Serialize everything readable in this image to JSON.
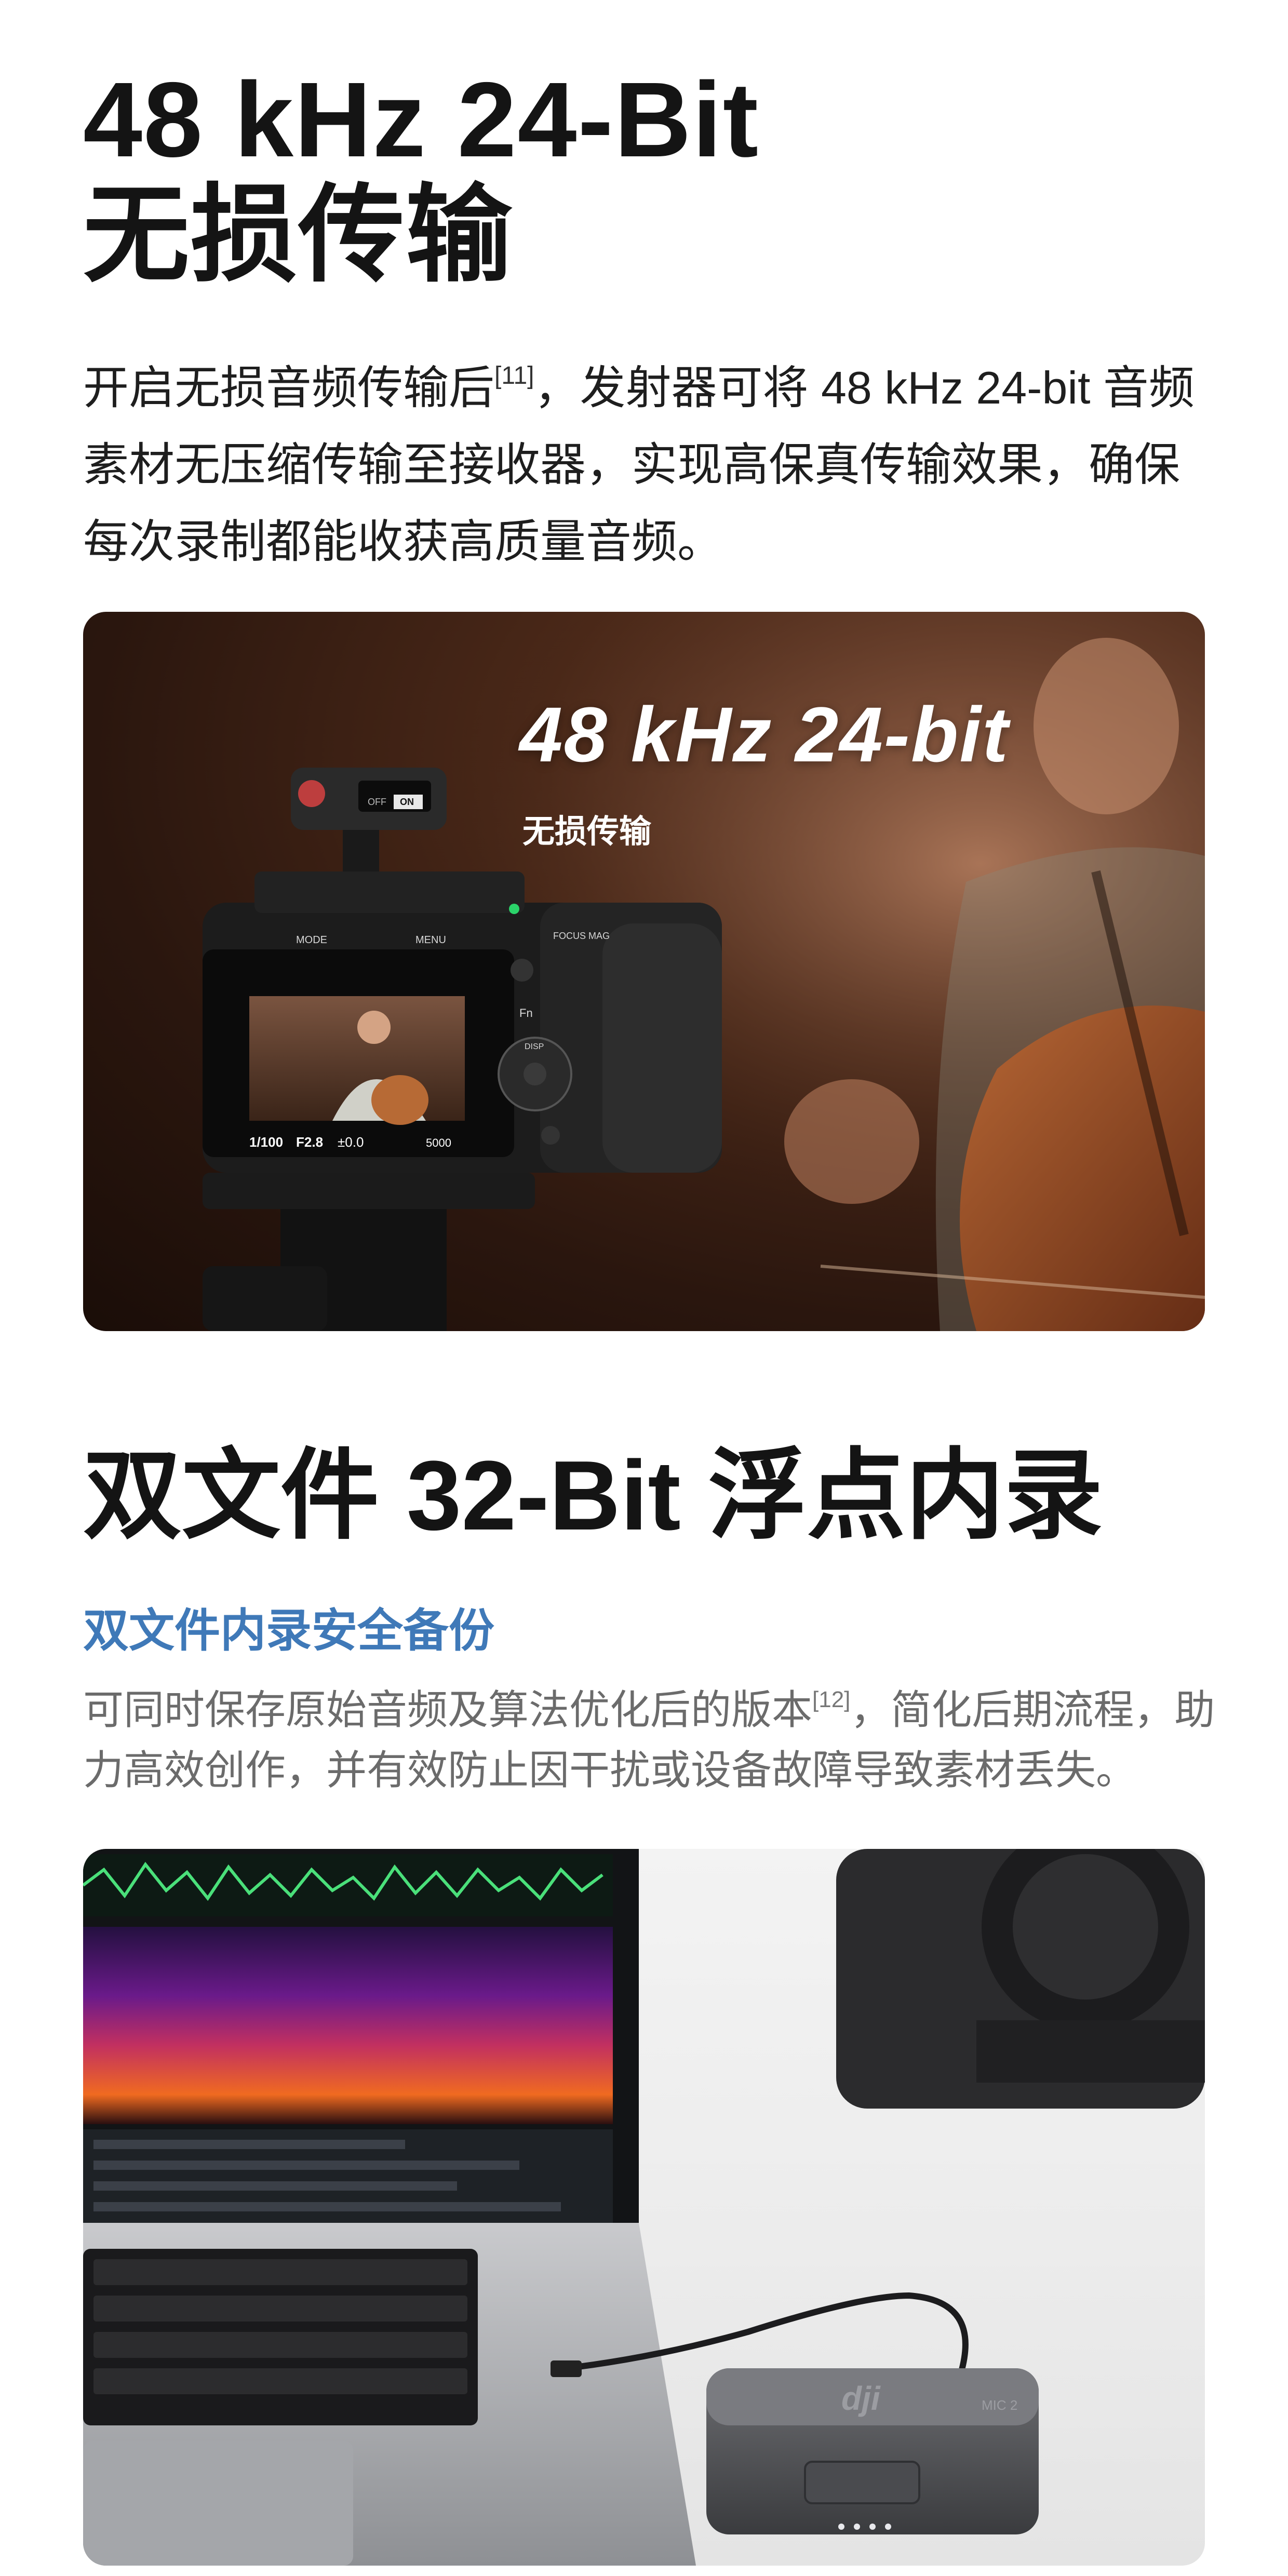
{
  "section1": {
    "title_line1": "48 kHz 24-Bit",
    "title_line2": "无损传输",
    "description_pre": "开启无损音频传输后",
    "footnote": "[11]",
    "description_post": "，发射器可将 48 kHz 24-bit 音频素材无压缩传输至接收器，实现高保真传输效果，确保每次录制都能收获高质量音频。",
    "photo": {
      "overlay_title": "48 kHz 24-bit",
      "overlay_subtitle": "无损传输",
      "camera_buttons": {
        "mode": "MODE",
        "menu": "MENU",
        "focus": "FOCUS MAG",
        "fn": "Fn",
        "disp": "DISP",
        "off": "OFF",
        "on": "ON"
      },
      "camera_screen": {
        "shutter": "1/100",
        "aperture": "F2.8",
        "exposure": "±0.0",
        "iso": "5000"
      }
    }
  },
  "section2": {
    "title": "双文件 32-Bit 浮点内录",
    "subtitle": "双文件内录安全备份",
    "description_pre": "可同时保存原始音频及算法优化后的版本",
    "footnote": "[12]",
    "description_post": "，简化后期流程，助力高效创作，并有效防止因干扰或设备故障导致素材丢失。",
    "photo": {
      "case_logo": "dji",
      "case_label": "MIC 2"
    }
  },
  "colors": {
    "title": "#141414",
    "accent_subtitle": "#3f79b8",
    "muted_text": "#6b6b6b"
  }
}
